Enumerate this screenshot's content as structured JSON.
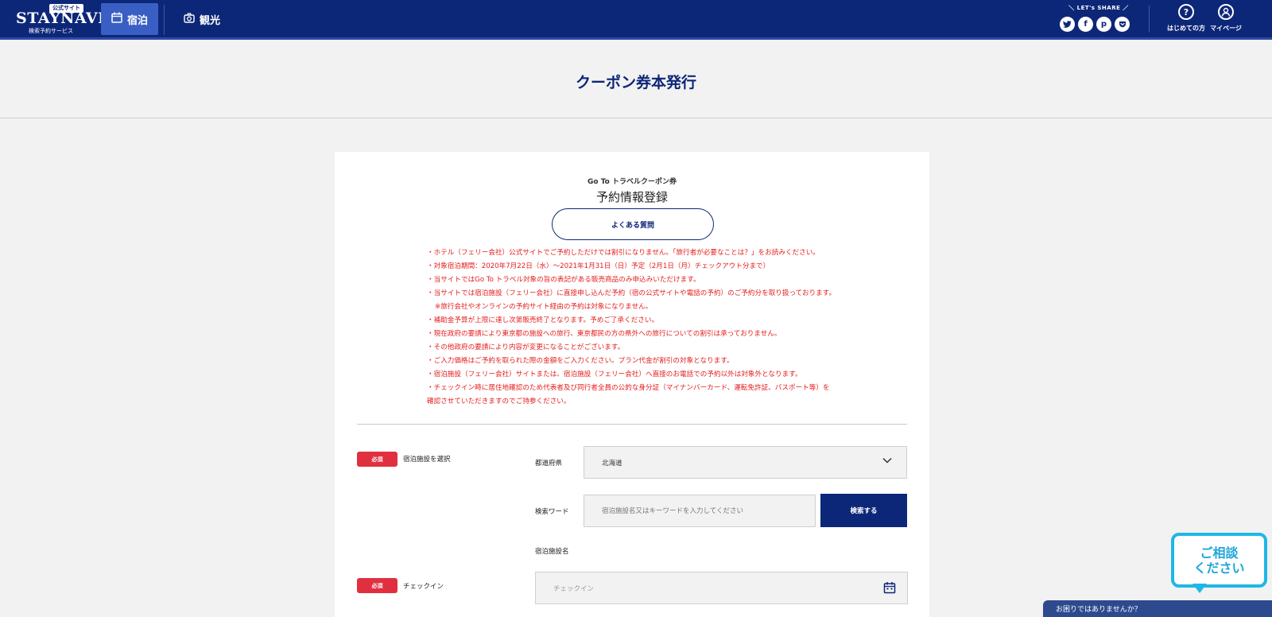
{
  "header": {
    "logo_text": "STAYNAVI",
    "logo_badge": "公式サイト",
    "logo_sub": "検索予約サービス",
    "nav": [
      {
        "label": "宿泊"
      },
      {
        "label": "観光"
      }
    ],
    "share_label": "LET's SHARE",
    "share_icons": [
      "twitter-icon",
      "facebook-icon",
      "pinterest-icon",
      "pocket-icon"
    ],
    "first_time_label": "はじめての方",
    "mypage_label": "マイページ"
  },
  "page": {
    "title": "クーポン券本発行"
  },
  "card": {
    "subtitle": "Go To トラベルクーポン券",
    "title": "予約情報登録",
    "faq_label": "よくある質問",
    "notices": [
      "・ホテル（フェリー会社）公式サイトでご予約しただけでは割引になりません。「旅行者が必要なことは？」をお読みください。",
      "・対象宿泊期間：2020年7月22日（水）～2021年1月31日（日）予定（2月1日（月）チェックアウト分まで）",
      "・当サイトではGo To トラベル対象の旨の表記がある販売商品のみ申込みいただけます。",
      "・当サイトでは宿泊施設（フェリー会社）に直接申し込んだ予約（宿の公式サイトや電話の予約）のご予約分を取り扱っております。",
      "※旅行会社やオンラインの予約サイト経由の予約は対象になりません。",
      "・補助金予算が上限に達し次第販売終了となります。予めご了承ください。",
      "・現在政府の要請により東京都の施設への旅行、東京都民の方の県外への旅行についての割引は承っておりません。",
      "・その他政府の要請により内容が変更になることがございます。",
      "・ご入力価格はご予約を取られた際の金額をご入力ください。プラン代金が割引の対象となります。",
      "・宿泊施設（フェリー会社）サイトまたは、宿泊施設（フェリー会社）へ直接のお電話での予約以外は対象外となります。",
      "・チェックイン時に居住地確認のため代表者及び同行者全員の公的な身分証（マイナンバーカード、運転免許証、パスポート等）を",
      "確認させていただきますのでご持参ください。"
    ],
    "required_label": "必須",
    "facility_section_label": "宿泊施設を選択",
    "prefecture_label": "都道府県",
    "prefecture_value": "北海道",
    "keyword_label": "検索ワード",
    "keyword_placeholder": "宿泊施設名又はキーワードを入力してください",
    "search_button": "検索する",
    "facility_name_label": "宿泊施設名",
    "checkin_section_label": "チェックイン",
    "checkin_placeholder": "チェックイン"
  },
  "chat": {
    "bubble_line1": "ご相談",
    "bubble_line2": "ください",
    "bar_text": "お困りではありませんか？"
  },
  "colors": {
    "primary": "#0d2778",
    "accent_red": "#e51c1c",
    "required_badge": "#e03040",
    "chat_blue": "#1fb7e6"
  }
}
